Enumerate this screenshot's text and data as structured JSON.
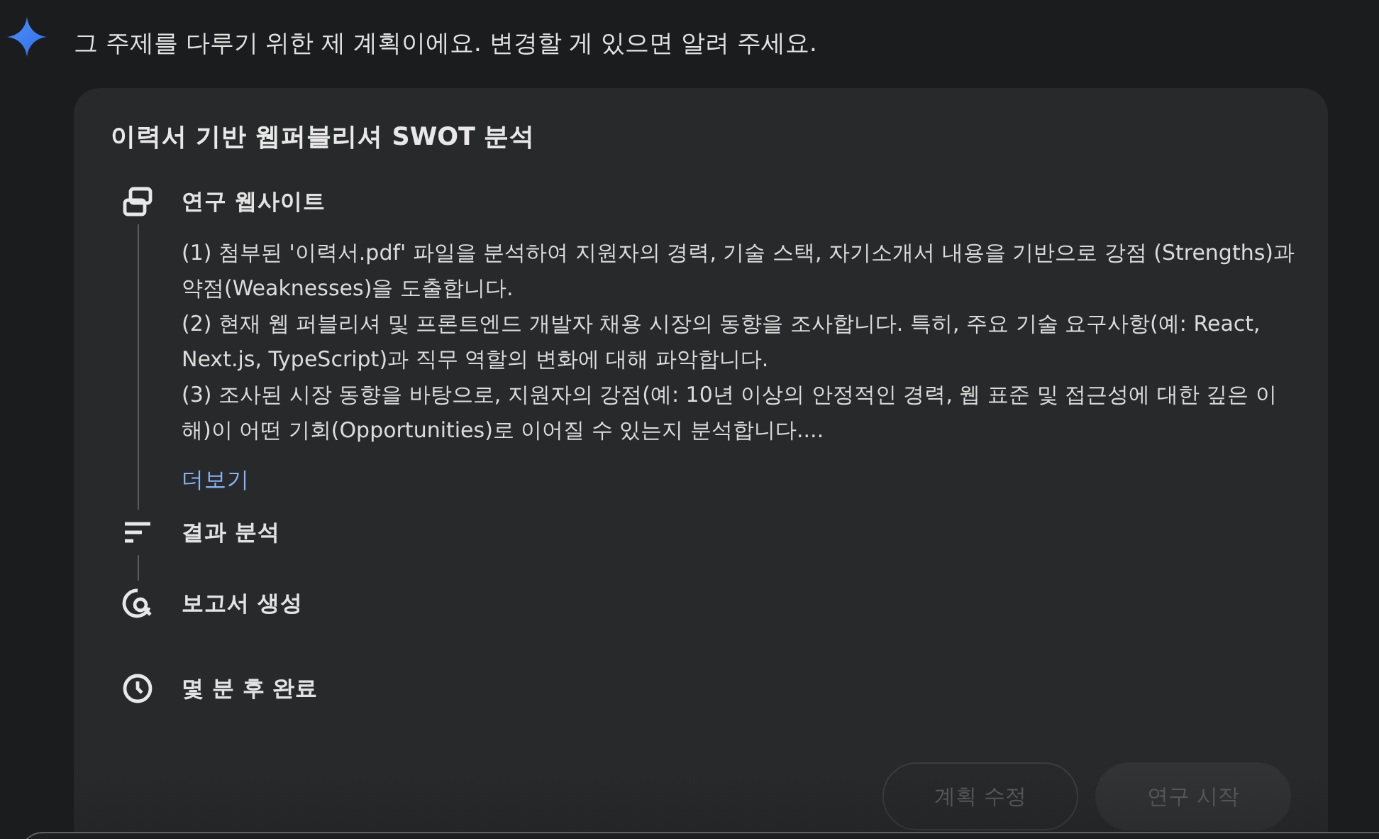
{
  "message": "그 주제를 다루기 위한 제 계획이에요. 변경할 게 있으면 알려 주세요.",
  "plan": {
    "title": "이력서 기반 웹퍼블리셔 SWOT 분석",
    "steps": [
      {
        "kind": "website",
        "label": "연구 웹사이트",
        "expanded": true,
        "description": [
          "(1) 첨부된 '이력서.pdf' 파일을 분석하여 지원자의 경력, 기술 스택, 자기소개서 내용을 기반으로 강점 (Strengths)과 약점(Weaknesses)을 도출합니다.",
          "(2) 현재 웹 퍼블리셔 및 프론트엔드 개발자 채용 시장의 동향을 조사합니다. 특히, 주요 기술 요구사항(예: React, Next.js, TypeScript)과 직무 역할의 변화에 대해 파악합니다.",
          "(3) 조사된 시장 동향을 바탕으로, 지원자의 강점(예: 10년 이상의 안정적인 경력, 웹 표준 및 접근성에 대한 깊은 이해)이 어떤 기회(Opportunities)로 이어질 수 있는지 분석합니다...."
        ],
        "more": "더보기"
      },
      {
        "kind": "analysis",
        "label": "결과 분석",
        "expanded": false
      },
      {
        "kind": "report",
        "label": "보고서 생성",
        "expanded": false
      }
    ],
    "eta": "몇 분 후 완료",
    "buttons": [
      {
        "kind": "outline",
        "label": "계획 수정"
      },
      {
        "kind": "filled",
        "label": "연구 시작"
      }
    ]
  }
}
